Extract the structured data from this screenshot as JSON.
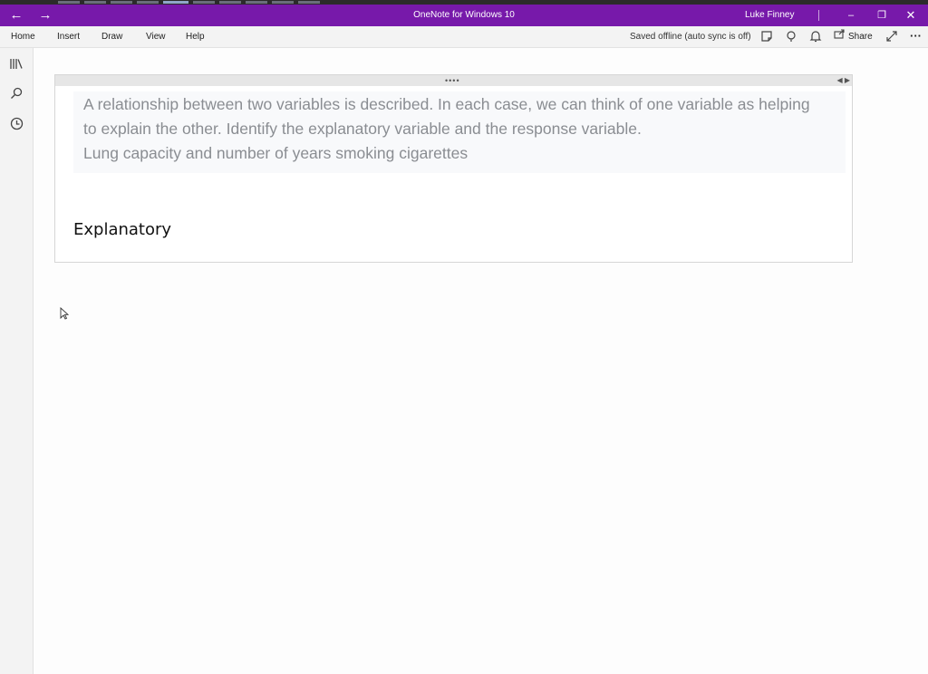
{
  "titlebar": {
    "back_icon": "back-arrow-icon",
    "forward_icon": "forward-arrow-icon",
    "app_title": "OneNote for Windows 10",
    "user_name": "Luke Finney",
    "minimize_glyph": "–",
    "maximize_glyph": "❐",
    "close_glyph": "✕",
    "accent_color": "#7719aa"
  },
  "menubar": {
    "tabs": [
      "Home",
      "Insert",
      "Draw",
      "View",
      "Help"
    ],
    "status": "Saved offline (auto sync is off)",
    "share_label": "Share",
    "more_glyph": "···",
    "icons": [
      "sticky-notes-icon",
      "lightbulb-icon",
      "bell-icon",
      "share-icon",
      "expand-icon",
      "more-icon"
    ]
  },
  "rail": {
    "icons": [
      "notebooks-icon",
      "search-icon",
      "recent-icon"
    ]
  },
  "note": {
    "grip": "••••",
    "arrows": "◀ ▶",
    "question_lines": [
      "A relationship between two variables is described. In each case, we can think of one variable as helping",
      "to explain the other. Identify the explanatory variable and the response variable.",
      "Lung capacity and number of years smoking cigarettes"
    ],
    "answer_text": "Explanatory"
  }
}
